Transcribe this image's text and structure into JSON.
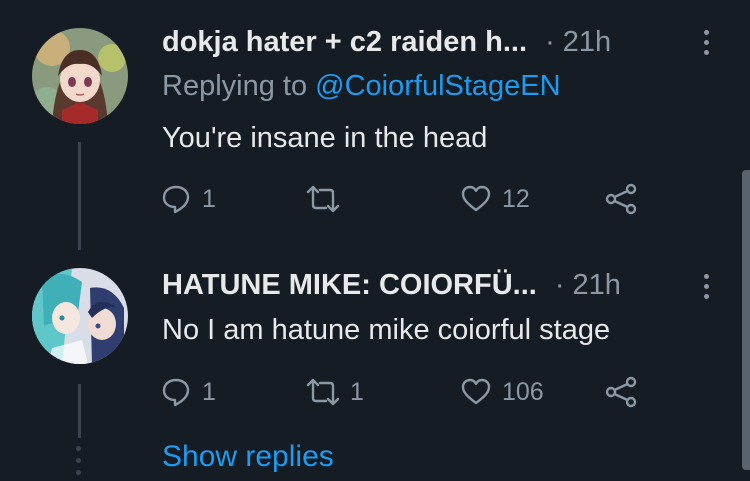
{
  "tweets": [
    {
      "display_name": "dokja hater + c2 raiden h...",
      "separator": "·",
      "time": "21h",
      "replying_prefix": "Replying to ",
      "replying_handle": "@CoiorfulStageEN",
      "text": "You're insane in the head",
      "actions": {
        "replies": "1",
        "retweets": "",
        "likes": "12"
      },
      "avatar_icon": "anime-girl-avatar"
    },
    {
      "display_name": "HATUNE MIKE: COIORFÜ...",
      "separator": "·",
      "time": "21h",
      "text": "No I am hatune mike coiorful stage",
      "actions": {
        "replies": "1",
        "retweets": "1",
        "likes": "106"
      },
      "avatar_icon": "miku-avatar"
    }
  ],
  "show_replies": "Show replies",
  "colors": {
    "background": "#161c24",
    "link": "#1d9bf0",
    "muted": "#8b98a5",
    "text": "#e7e9ea"
  },
  "icons": [
    "reply-icon",
    "retweet-icon",
    "like-icon",
    "share-icon",
    "more-icon"
  ]
}
